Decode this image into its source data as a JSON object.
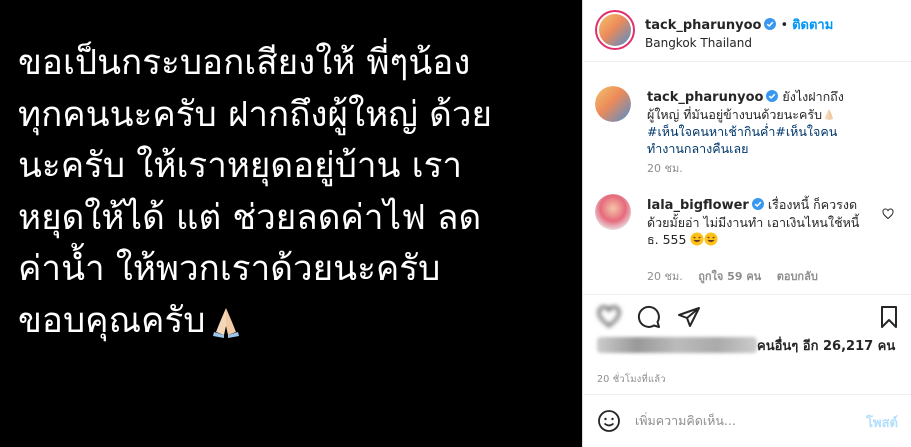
{
  "post": {
    "caption_image_text": "ขอเป็นกระบอกเสียงให้ พี่ๆน้อง\nทุกคนนะครับ ฝากถึงผู้ใหญ่ ด้วย\nนะครับ ให้เราหยุดอยู่บ้าน เรา\nหยุดให้ได้ แต่ ช่วยลดค่าไฟ ลด\nค่าน้ำ ให้พวกเราด้วยนะครับ\nขอบคุณครับ"
  },
  "header": {
    "username": "tack_pharunyoo",
    "separator": "•",
    "follow_label": "ติดตาม",
    "location": "Bangkok Thailand"
  },
  "comments": [
    {
      "username": "tack_pharunyoo",
      "text": "ยังไงฝากถึง ผู้ใหญ่ ที่มันอยู่ข้างบนด้วยนะครับ",
      "hashtags": "#เห็นใจคนหาเช้ากินค่ำ#เห็นใจคนทำงานกลางคืนเลย",
      "time": "20 ชม."
    },
    {
      "username": "lala_bigflower",
      "text": "เรื่องหนี้ ก็ควรงดด้วยมั้ยอ่า ไม่มีงานทำ เอาเงินไหนใช้หนี้ ธ. 555",
      "time": "20 ชม.",
      "likes": "ถูกใจ 59 คน",
      "reply_label": "ตอบกลับ"
    }
  ],
  "likes": {
    "text": "คนอื่นๆ อีก 26,217 คน"
  },
  "time_ago": "20 ชั่วโมงที่แล้ว",
  "add_comment": {
    "placeholder": "เพิ่มความคิดเห็น...",
    "post_label": "โพสต์"
  },
  "colors": {
    "link_blue": "#0095f6",
    "hashtag": "#00376b",
    "muted": "#8e8e8e",
    "verified": "#3897f0"
  },
  "icons": [
    "heart-icon",
    "comment-icon",
    "share-icon",
    "bookmark-icon",
    "smile-icon",
    "verified-icon",
    "heart-small-icon"
  ]
}
